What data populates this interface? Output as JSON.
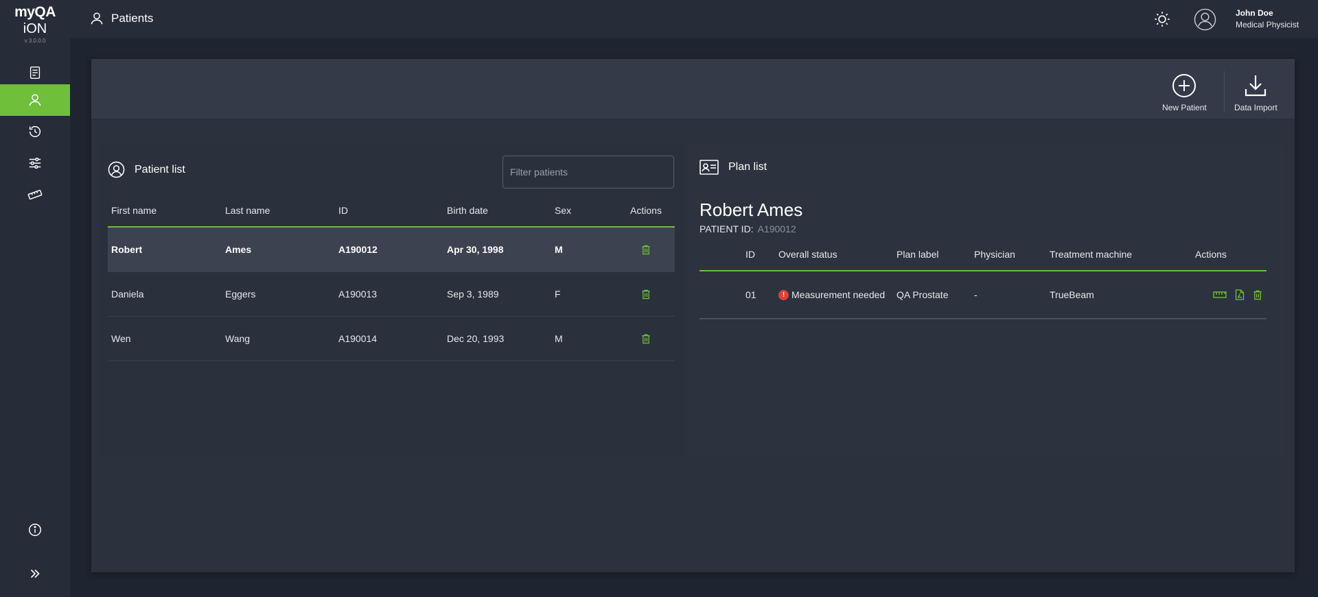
{
  "app": {
    "logo_line1": "myQA",
    "logo_line2": "iON",
    "version": "v 3.0.0.0"
  },
  "sidebar": {
    "items": [
      {
        "name": "reports",
        "icon": "checklist-icon",
        "active": false
      },
      {
        "name": "patients",
        "icon": "user-icon",
        "active": true
      },
      {
        "name": "history",
        "icon": "history-icon",
        "active": false
      },
      {
        "name": "settings",
        "icon": "sliders-icon",
        "active": false
      },
      {
        "name": "measure",
        "icon": "ruler-icon",
        "active": false
      }
    ],
    "bottom": [
      {
        "name": "info",
        "icon": "info-icon"
      },
      {
        "name": "expand",
        "icon": "chevron-double-right-icon"
      }
    ]
  },
  "header": {
    "title": "Patients",
    "theme_icon": "sun-icon",
    "user_name": "John Doe",
    "user_role": "Medical Physicist"
  },
  "toolbar": {
    "new_patient_label": "New Patient",
    "data_import_label": "Data Import"
  },
  "patient_list": {
    "title": "Patient list",
    "filter_placeholder": "Filter patients",
    "columns": [
      "First name",
      "Last name",
      "ID",
      "Birth date",
      "Sex",
      "Actions"
    ],
    "rows": [
      {
        "first": "Robert",
        "last": "Ames",
        "id": "A190012",
        "birth": "Apr 30, 1998",
        "sex": "M",
        "selected": true
      },
      {
        "first": "Daniela",
        "last": "Eggers",
        "id": "A190013",
        "birth": "Sep 3, 1989",
        "sex": "F",
        "selected": false
      },
      {
        "first": "Wen",
        "last": "Wang",
        "id": "A190014",
        "birth": "Dec 20, 1993",
        "sex": "M",
        "selected": false
      }
    ]
  },
  "plan_list": {
    "title": "Plan list",
    "patient_name": "Robert Ames",
    "patient_id_label": "PATIENT ID:",
    "patient_id_value": "A190012",
    "columns": [
      "ID",
      "Overall status",
      "Plan label",
      "Physician",
      "Treatment machine",
      "Actions"
    ],
    "rows": [
      {
        "id": "01",
        "status": "Measurement needed",
        "plan_label": "QA Prostate",
        "physician": "-",
        "machine": "TrueBeam"
      }
    ]
  },
  "colors": {
    "accent": "#6fbf3a",
    "error": "#e0403a"
  }
}
